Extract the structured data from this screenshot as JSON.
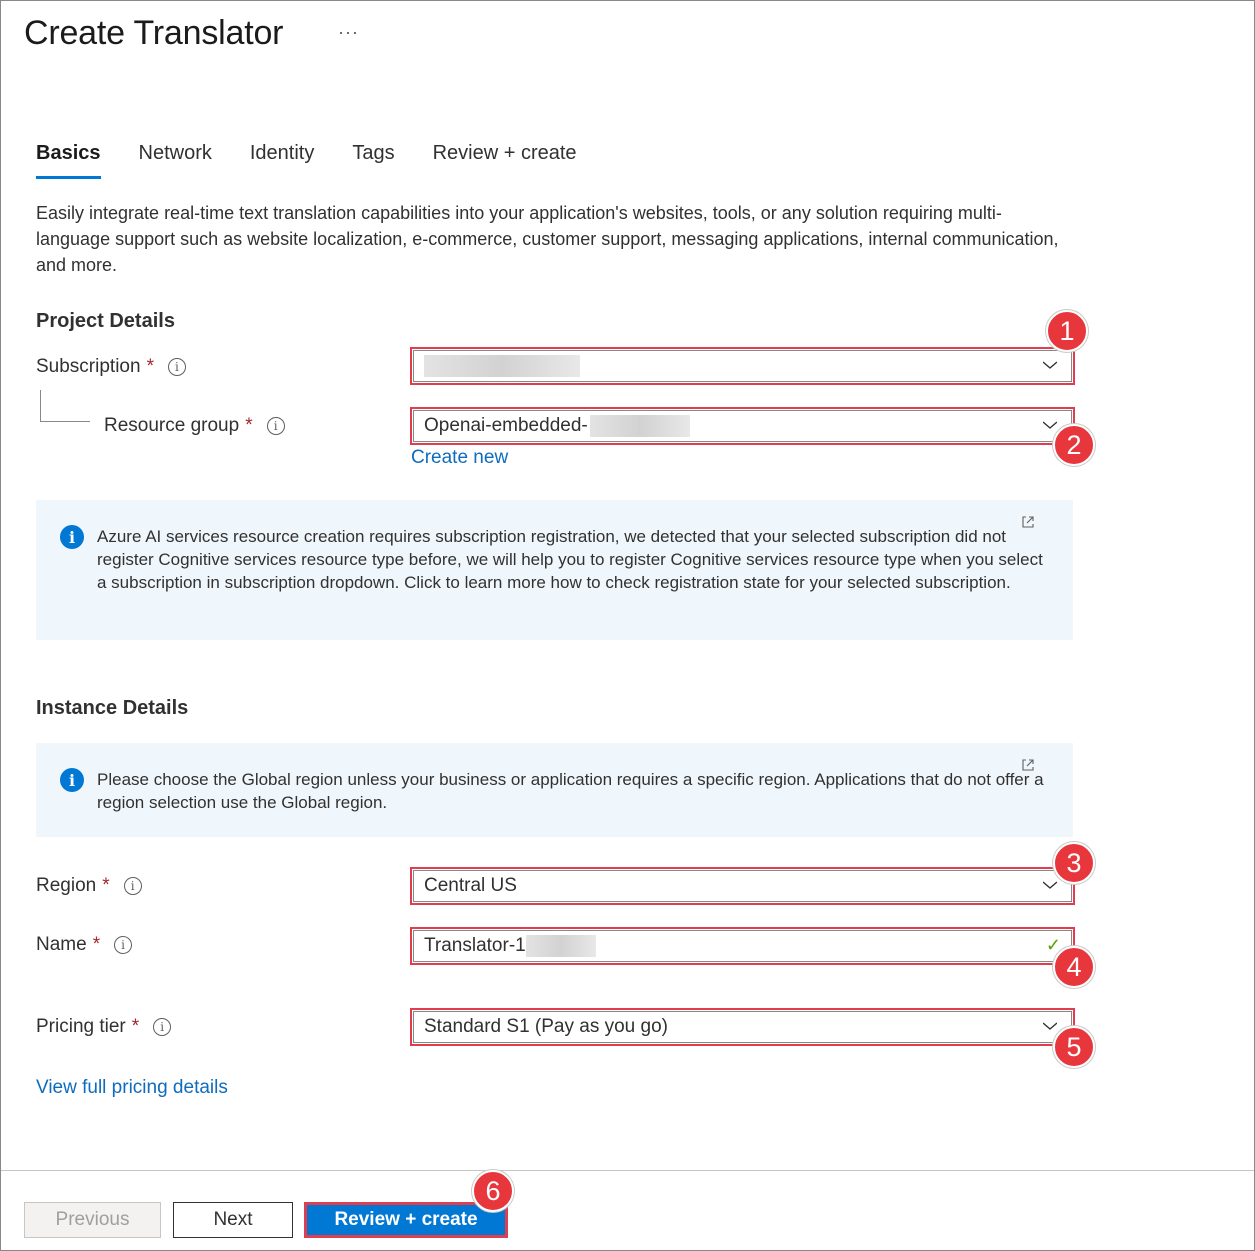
{
  "header": {
    "title": "Create Translator",
    "more_label": "···"
  },
  "tabs": [
    {
      "label": "Basics",
      "active": true
    },
    {
      "label": "Network",
      "active": false
    },
    {
      "label": "Identity",
      "active": false
    },
    {
      "label": "Tags",
      "active": false
    },
    {
      "label": "Review + create",
      "active": false
    }
  ],
  "intro": "Easily integrate real-time text translation capabilities into your application's websites, tools, or any solution requiring multi-language support such as website localization, e-commerce, customer support, messaging applications, internal communication, and more.",
  "project_details": {
    "title": "Project Details",
    "subscription": {
      "label": "Subscription",
      "required": "*",
      "value": ""
    },
    "resource_group": {
      "label": "Resource group",
      "required": "*",
      "value": "Openai-embedded-"
    },
    "create_new": "Create new"
  },
  "info_registration": "Azure AI services resource creation requires subscription registration, we detected that your selected subscription did not register Cognitive services resource type before, we will help you to register Cognitive services resource type when you select a subscription in subscription dropdown. Click to learn more how to check registration state for your selected subscription.",
  "instance_details": {
    "title": "Instance Details",
    "info_region": "Please choose the Global region unless your business or application requires a specific region. Applications that do not offer a region selection use the Global region.",
    "region": {
      "label": "Region",
      "required": "*",
      "value": "Central US"
    },
    "name": {
      "label": "Name",
      "required": "*",
      "value": "Translator-1"
    },
    "pricing_tier": {
      "label": "Pricing tier",
      "required": "*",
      "value": "Standard S1 (Pay as you go)"
    },
    "pricing_link": "View full pricing details"
  },
  "footer": {
    "previous": "Previous",
    "next": "Next",
    "review_create": "Review + create"
  },
  "callouts": [
    "1",
    "2",
    "3",
    "4",
    "5",
    "6"
  ],
  "colors": {
    "accent": "#0078d4",
    "callout": "#e8363d",
    "highlight_border": "#e03e4f"
  }
}
